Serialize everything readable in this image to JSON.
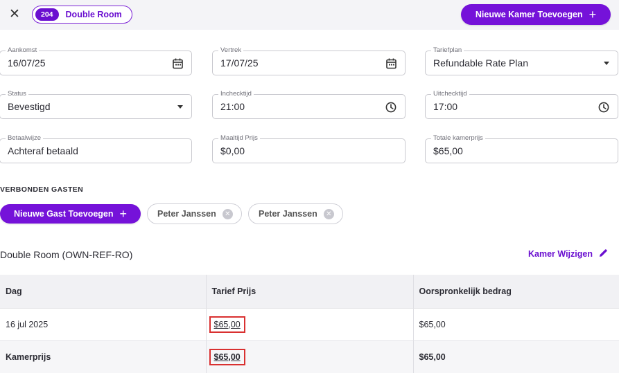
{
  "header": {
    "room_number": "204",
    "room_name": "Double Room",
    "add_room_label": "Nieuwe Kamer Toevoegen"
  },
  "fields": {
    "aankomst": {
      "label": "Aankomst",
      "value": "16/07/25"
    },
    "vertrek": {
      "label": "Vertrek",
      "value": "17/07/25"
    },
    "tariefplan": {
      "label": "Tariefplan",
      "value": "Refundable Rate Plan"
    },
    "status": {
      "label": "Status",
      "value": "Bevestigd"
    },
    "inchecktijd": {
      "label": "Inchecktijd",
      "value": "21:00"
    },
    "uitchecktijd": {
      "label": "Uitchecktijd",
      "value": "17:00"
    },
    "betaalwijze": {
      "label": "Betaalwijze",
      "value": "Achteraf betaald"
    },
    "maaltijd_prijs": {
      "label": "Maaltijd Prijs",
      "value": "$0,00"
    },
    "totale_kamerprijs": {
      "label": "Totale kamerprijs",
      "value": "$65,00"
    }
  },
  "guests": {
    "section_title": "VERBONDEN GASTEN",
    "add_label": "Nieuwe Gast Toevoegen",
    "list": [
      "Peter Janssen",
      "Peter Janssen"
    ]
  },
  "room": {
    "title": "Double Room (OWN-REF-RO)",
    "change_label": "Kamer Wijzigen"
  },
  "table": {
    "headers": [
      "Dag",
      "Tarief Prijs",
      "Oorspronkelijk bedrag"
    ],
    "rows": [
      {
        "day": "16 jul 2025",
        "rate": "$65,00",
        "original": "$65,00"
      }
    ],
    "total": {
      "label": "Kamerprijs",
      "rate": "$65,00",
      "original": "$65,00"
    }
  },
  "colors": {
    "accent": "#7512d9",
    "highlight_border": "#d93030"
  }
}
